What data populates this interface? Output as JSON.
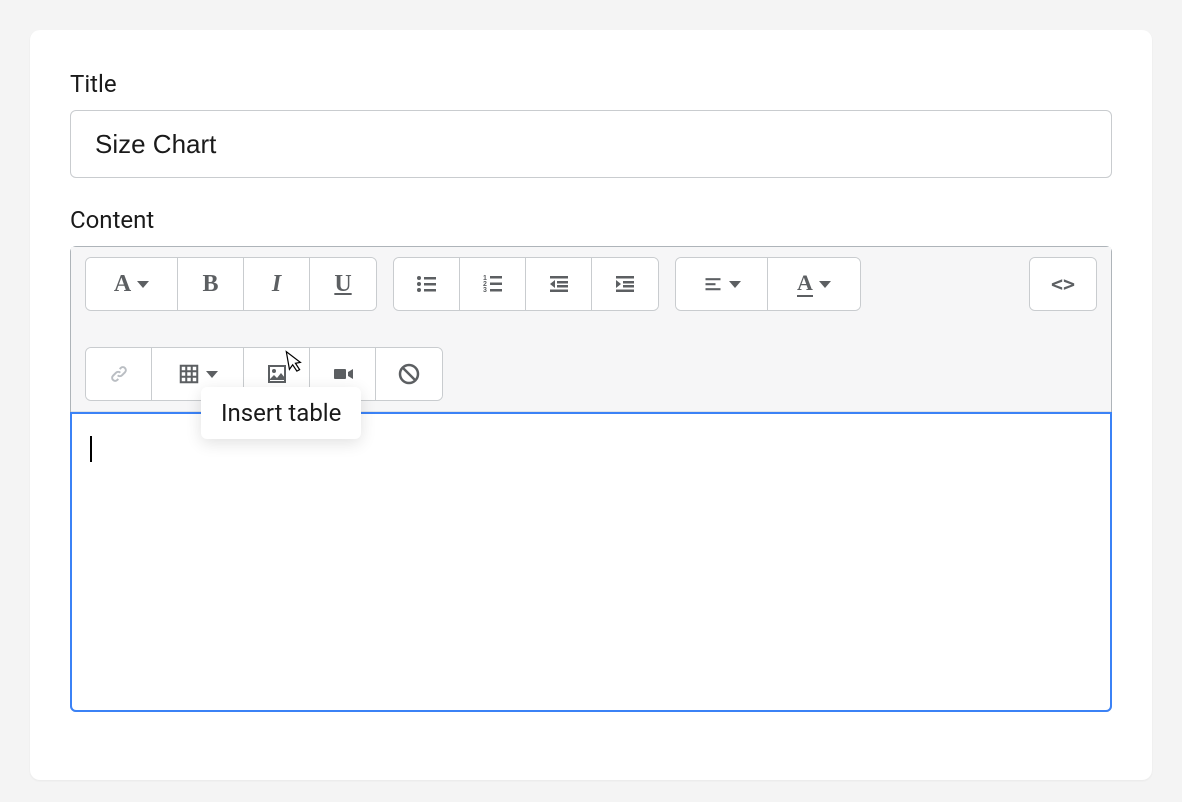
{
  "form": {
    "title_label": "Title",
    "title_value": "Size Chart",
    "content_label": "Content"
  },
  "toolbar": {
    "font_family_symbol": "A",
    "bold_symbol": "B",
    "italic_symbol": "I",
    "underline_symbol": "U",
    "text_color_symbol": "A",
    "code_symbol": "<>"
  },
  "tooltip_text": "Insert table"
}
